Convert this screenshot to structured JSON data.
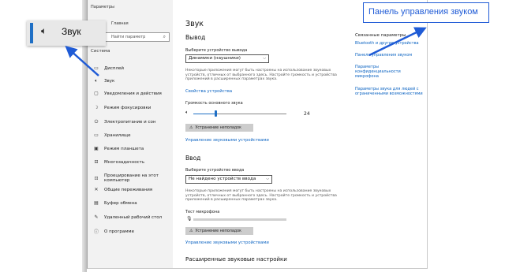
{
  "window": {
    "title": "Параметры",
    "home": "Главная",
    "search_placeholder": "Найти параметр",
    "search_icon": "search-icon",
    "section": "Система"
  },
  "sidebar": {
    "items": [
      {
        "label": "Дисплей",
        "icon": "display-icon",
        "glyph": "▭"
      },
      {
        "label": "Звук",
        "icon": "speaker-icon",
        "glyph": "🔈︎"
      },
      {
        "label": "Уведомления и действия",
        "icon": "notification-icon",
        "glyph": "▢"
      },
      {
        "label": "Режим фокусировки",
        "icon": "moon-icon",
        "glyph": "☽"
      },
      {
        "label": "Электропитание и сон",
        "icon": "power-icon",
        "glyph": "⏻"
      },
      {
        "label": "Хранилище",
        "icon": "storage-icon",
        "glyph": "▭"
      },
      {
        "label": "Режим планшета",
        "icon": "tablet-icon",
        "glyph": "▣"
      },
      {
        "label": "Многозадачность",
        "icon": "multitask-icon",
        "glyph": "⊟"
      },
      {
        "label": "Проецирование на этот компьютер",
        "icon": "project-icon",
        "glyph": "⊡"
      },
      {
        "label": "Общие переживания",
        "icon": "share-icon",
        "glyph": "✕"
      },
      {
        "label": "Буфер обмена",
        "icon": "clipboard-icon",
        "glyph": "▤"
      },
      {
        "label": "Удаленный рабочий стол",
        "icon": "remote-icon",
        "glyph": "✎"
      },
      {
        "label": "О программе",
        "icon": "info-icon",
        "glyph": "ⓘ"
      }
    ]
  },
  "main": {
    "title": "Звук",
    "output": {
      "heading": "Вывод",
      "choose_label": "Выберите устройство вывода",
      "device": "Динамики (наушники)",
      "note": "Некоторые приложения могут быть настроены на использование звуковых устройств, отличных от выбранного здесь. Настройте громкость и устройства приложений в расширенных параметрах звука.",
      "properties_link": "Свойства устройства",
      "volume_label": "Громкость основного звука",
      "volume": 24,
      "troubleshoot": "Устранение неполадок",
      "manage_link": "Управление звуковыми устройствами"
    },
    "input": {
      "heading": "Ввод",
      "choose_label": "Выберите устройство ввода",
      "device": "Не найдено устройств ввода",
      "note": "Некоторые приложения могут быть настроены на использование звуковых устройств, отличных от выбранного здесь. Настройте громкость и устройства приложений в расширенных параметрах звука.",
      "mic_label": "Тест микрофона",
      "troubleshoot": "Устранение неполадок",
      "manage_link": "Управление звуковыми устройствами"
    },
    "advanced_heading": "Расширенные звуковые настройки"
  },
  "related": {
    "title": "Связанные параметры",
    "links": [
      "Bluetooth и другие устройства",
      "Панель управления звуком",
      "Параметры конфиденциальности микрофона",
      "Параметры звука для людей с ограниченными возможностями"
    ]
  },
  "callout": {
    "text": "Панель управления звуком"
  },
  "chip": {
    "label": "Звук",
    "icon": "speaker-icon"
  },
  "colors": {
    "accent": "#1f6fc5",
    "link": "#0b63c2",
    "annotation": "#1f5bd6"
  }
}
